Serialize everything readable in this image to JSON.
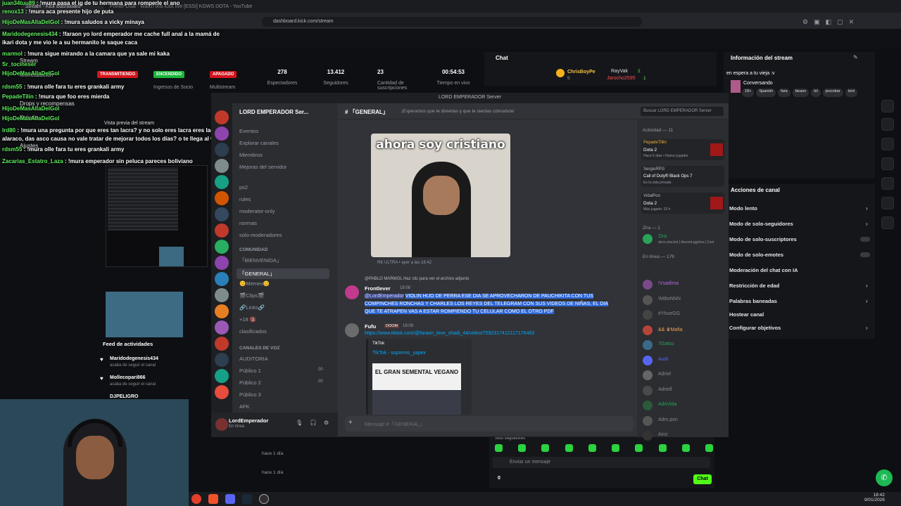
{
  "browser": {
    "tabs": [
      "Stream - Kick Dashboard",
      "Primer Dual - Watch this Kick live",
      "[ESSI] KGWS DOTA - YouTube"
    ],
    "url": "dashboard.kick.com/stream"
  },
  "kick": {
    "sidebar": [
      {
        "label": "Stream"
      },
      {
        "label": "Monetización"
      },
      {
        "label": "Drops y recompensas"
      },
      {
        "label": "Estudio"
      },
      {
        "label": "Ajustes"
      }
    ],
    "preview_label": "Vista previa del stream",
    "feed_title": "Feed de actividades",
    "feed": [
      {
        "user": "Maridodegenesis434",
        "action": "acaba de seguir el canal",
        "time": "hace 1 día"
      },
      {
        "user": "Mollecopari866",
        "action": "acaba de seguir el canal",
        "time": "hace 1 día"
      },
      {
        "user": "DJPELIGRO",
        "action": "",
        "time": ""
      }
    ],
    "badges": {
      "transmitiendo": "TRANSMITIENDO",
      "encendido": "ENCENDIDO",
      "apagado": "APAGADO"
    },
    "badge_captions": {
      "socio": "Ingresos de Socio",
      "multistream": "Multistream"
    },
    "stats": [
      {
        "value": "278",
        "label": "Espectadores"
      },
      {
        "value": "13.412",
        "label": "Seguidores"
      },
      {
        "value": "23",
        "label": "Cantidad de suscripciones"
      },
      {
        "value": "00:54:53",
        "label": "Tiempo en vivo"
      }
    ],
    "chat": {
      "title": "Chat",
      "top_users": [
        "ChrisBoyPe",
        "RayVak",
        "Jarocho2595"
      ],
      "top_counts": [
        "5",
        "2",
        "1"
      ],
      "input_placeholder": "Enviar un mensaje",
      "send": "Chat",
      "mode": "Solo seguidores",
      "count": "0"
    },
    "info": {
      "title": "Información del stream",
      "stream_title": "en espera a tu vieja :v",
      "category": "Conversando",
      "tags": [
        "18+",
        "Spanish",
        "fara",
        "faraon",
        "lol",
        "jescobar",
        "lord"
      ]
    },
    "actions": {
      "title": "Acciones de canal",
      "items": [
        "Modo lento",
        "Modo de solo-seguidores",
        "Modo de solo-suscriptores",
        "Modo de solo-emotes",
        "Moderación del chat con IA",
        "Restricción de edad",
        "Palabras baneadas",
        "Hostear canal",
        "Configurar objetivos"
      ]
    }
  },
  "overlay_chat": [
    {
      "user": "juan34tuu89",
      "msg": "!mura pasa el ig de tu hermana para romperle el ano"
    },
    {
      "user": "renox13",
      "msg": "!mura aca presente hijo de puta"
    },
    {
      "user": "HijoDeMasAllaDelGol",
      "msg": "!mura saludos a vicky minaya"
    },
    {
      "user": "Maridodegenesis434",
      "msg": "!faraon yo lord emperador me cache full anal a la mamá de"
    },
    {
      "user": "",
      "msg": "ikari dota y me vio le a su hermanito le saque caca"
    },
    {
      "user": "marmol",
      "msg": "!mura sigue mirando a la camara que ya sale mi kaka"
    },
    {
      "user": "Sr_tocineser",
      "msg": ""
    },
    {
      "user": "HijoDeMasAllaDelGol",
      "msg": ""
    },
    {
      "user": "rdsm55",
      "msg": "!mura olle fara tu eres grankali army"
    },
    {
      "user": "PepadeTilin",
      "msg": "!mura que foo eres mierda"
    },
    {
      "user": "HijoDeMasAllaDelGol",
      "msg": ""
    },
    {
      "user": "HijoDeMasAllaDelGol",
      "msg": ""
    },
    {
      "user": "lrd80",
      "msg": "!mura una pregunta por que eres tan lacra? y no solo eres lacra eres lacra y"
    },
    {
      "user": "",
      "msg": "alaraco, das asco causa no vale tratar de mejorar todos los días? o te llega al webo?"
    },
    {
      "user": "rdsm55",
      "msg": "!mura olle fara tu eres grankali army"
    },
    {
      "user": "Zacarias_Estatro_Laza",
      "msg": "!mura emperador sin peluca pareces boliviano"
    }
  ],
  "discord": {
    "window_title": "LORD EMPERADOR Server",
    "server_name": "LORD EMPERADOR Ser...",
    "top_items": [
      "Eventos",
      "Explorar canales",
      "Miembros",
      "Mejoras del servidor"
    ],
    "channels": [
      "ps2",
      "rules",
      "moderator-only",
      "normas",
      "solo-moderadores"
    ],
    "category_community": "COMUNIDAD",
    "community_channels": [
      "「BIENVENIDA」",
      "「GENERAL」",
      "😊Memes😊",
      "🎬Clips🎬",
      "🔗Links🔗",
      "+18 🔞",
      "clasificados"
    ],
    "category_voice": "CANALES DE VOZ",
    "voice_channels": [
      "AUDITORIA",
      "Público 1",
      "Público 2",
      "Público 3",
      "AFK"
    ],
    "voice_counts": [
      "",
      "00",
      "00",
      ""
    ],
    "user": {
      "name": "LordEmperador",
      "status": "En línea"
    },
    "header": {
      "channel": "「GENERAL」",
      "topic": "¡Esperamos que te diviertas y que te sientas cómodo/a!",
      "search": "Buscar LORD EMPERADOR Server"
    },
    "image_caption": "ahora soy cristiano",
    "image_meta": "RK ULTRA • ayer a las 18:42",
    "reply": "@PABLO MARMOL  Haz clic para ver el archivo adjunto",
    "msg1": {
      "author": "Frontlever",
      "time": "18:08",
      "mention": "@LordEmperador",
      "text": "VIOLIN HIJO DE PERRA ESE DIA SE APROVECHARON DE PAUCHIKITA CON TUS COMPINCHES RONCHAS Y CHARLES LOS REYES DEL TELEGRAM CON SUS VIDEOS DE NIÑAS, EL DIA QUE TE ATRAPEN VAS A ESTAR ROMPIENDO TU CELULAR COMO EL OTRO PDF"
    },
    "msg2": {
      "author": "Fufu",
      "tag": "DOOM",
      "time": "18:09",
      "link": "https://www.tiktok.com/@faraon_love_shadi_44/video/7592317412117176463",
      "embed_provider": "TikTok",
      "embed_title": "TikTok - supremo_yapex",
      "embed_image_text": "EL GRAN SEMENTAL VEGANO"
    },
    "composer": "Mensaje #「GENERAL」",
    "activity": {
      "title": "Actividad — 11",
      "items": [
        {
          "user": "PepadeTillin",
          "game": "Dota 2",
          "meta": "Hace 6 días • Nuevo jugador"
        },
        {
          "user": "SergioRPG",
          "game": "Call of Duty® Black Ops 7",
          "meta": "Es la sala privada"
        },
        {
          "user": "VidalPoo",
          "game": "Dota 2",
          "meta": "Más jugado: 23 h"
        }
      ]
    },
    "zira_header": "Zira — 1",
    "zira": {
      "name": "Zira",
      "sub": "docs.zira.bot | discord.gg/zira | Cost"
    },
    "online_header": "En línea — 179",
    "members": [
      "!Vsadima",
      "!MiltoNNN",
      "#YhueGG",
      "&& ♛Mafia",
      "7Gatsu",
      "Audi",
      "Adriel",
      "Adriell",
      "AdriVida",
      "Adrx.pxn",
      "Ainz"
    ]
  },
  "taskbar": {
    "clock": "18:42",
    "date": "9/01/2026"
  }
}
